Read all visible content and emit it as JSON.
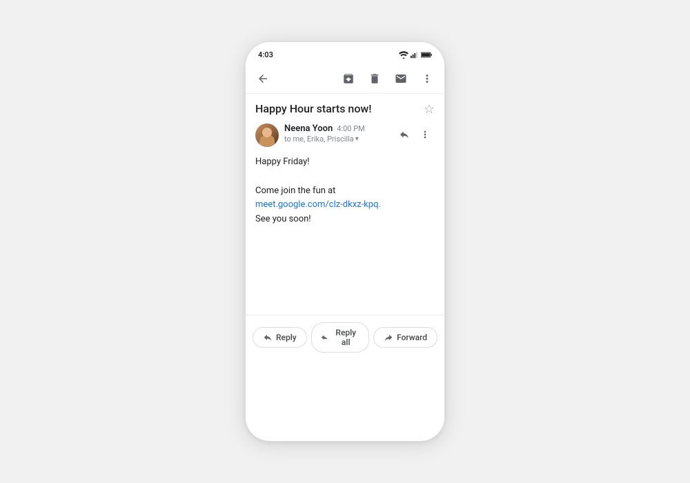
{
  "phone": {
    "status_bar": {
      "time": "4:03"
    },
    "toolbar": {
      "back_label": "back",
      "archive_label": "archive",
      "delete_label": "delete",
      "mark_unread_label": "mark unread",
      "more_label": "more options"
    },
    "email": {
      "subject": "Happy Hour starts now!",
      "sender": {
        "name": "Neena Yoon",
        "time": "4:00 PM",
        "to_line": "to me, Erika, Priscilla"
      },
      "body_line1": "Happy Friday!",
      "body_line2": "Come join the fun at",
      "body_link": "meet.google.com/clz-dkxz-kpq.",
      "body_line3": "See you soon!"
    },
    "actions": {
      "reply": "Reply",
      "reply_all": "Reply all",
      "forward": "Forward"
    }
  }
}
